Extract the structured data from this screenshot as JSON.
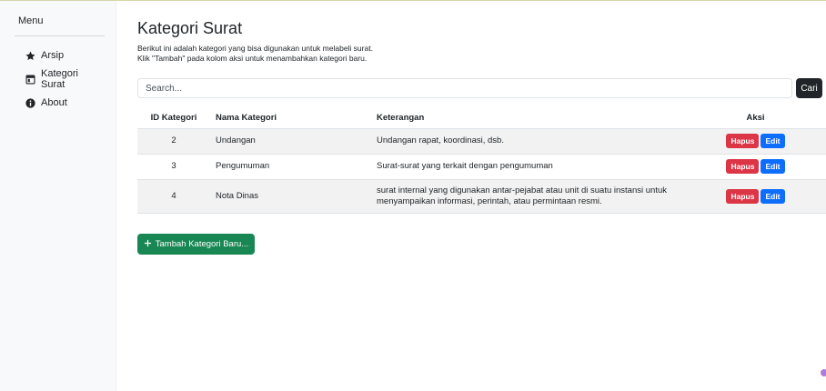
{
  "sidebar": {
    "title": "Menu",
    "items": [
      {
        "label": "Arsip",
        "icon": "star-icon"
      },
      {
        "label": "Kategori Surat",
        "icon": "window-icon"
      },
      {
        "label": "About",
        "icon": "info-circle-icon"
      }
    ]
  },
  "page": {
    "title": "Kategori Surat",
    "desc_line1": "Berikut ini adalah kategori yang bisa digunakan untuk melabeli surat.",
    "desc_line2": "Klik \"Tambah\" pada kolom aksi untuk menambahkan kategori baru."
  },
  "search": {
    "placeholder": "Search...",
    "button_label": "Cari"
  },
  "table": {
    "headers": [
      "ID Kategori",
      "Nama Kategori",
      "Keterangan",
      "Aksi"
    ],
    "rows": [
      {
        "id": "2",
        "name": "Undangan",
        "ket": "Undangan rapat, koordinasi, dsb."
      },
      {
        "id": "3",
        "name": "Pengumuman",
        "ket": "Surat-surat yang terkait dengan pengumuman"
      },
      {
        "id": "4",
        "name": "Nota Dinas",
        "ket": "surat internal yang digunakan antar-pejabat atau unit di suatu instansi untuk menyampaikan informasi, perintah, atau permintaan resmi."
      }
    ],
    "delete_label": "Hapus",
    "edit_label": "Edit"
  },
  "add_button": {
    "label": "Tambah Kategori Baru..."
  },
  "colors": {
    "delete": "#dc3545",
    "edit": "#0d6efd",
    "add": "#198754",
    "search_button": "#212529"
  }
}
